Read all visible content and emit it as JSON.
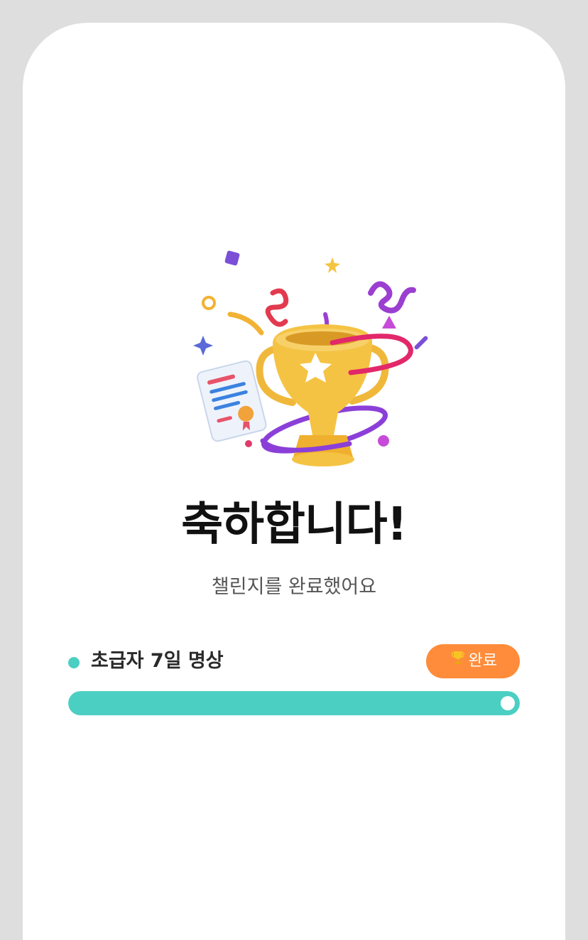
{
  "title": "축하합니다!",
  "subtitle": "챌린지를 완료했어요",
  "challenge": {
    "name": "초급자 7일 명상",
    "badge_label": "완료",
    "progress": 1.0
  },
  "colors": {
    "accent": "#4ccfc3",
    "badge": "#ff8c3a",
    "frame": "#dedede"
  },
  "icons": {
    "hero": "trophy-celebration-icon",
    "badge": "trophy-icon"
  }
}
